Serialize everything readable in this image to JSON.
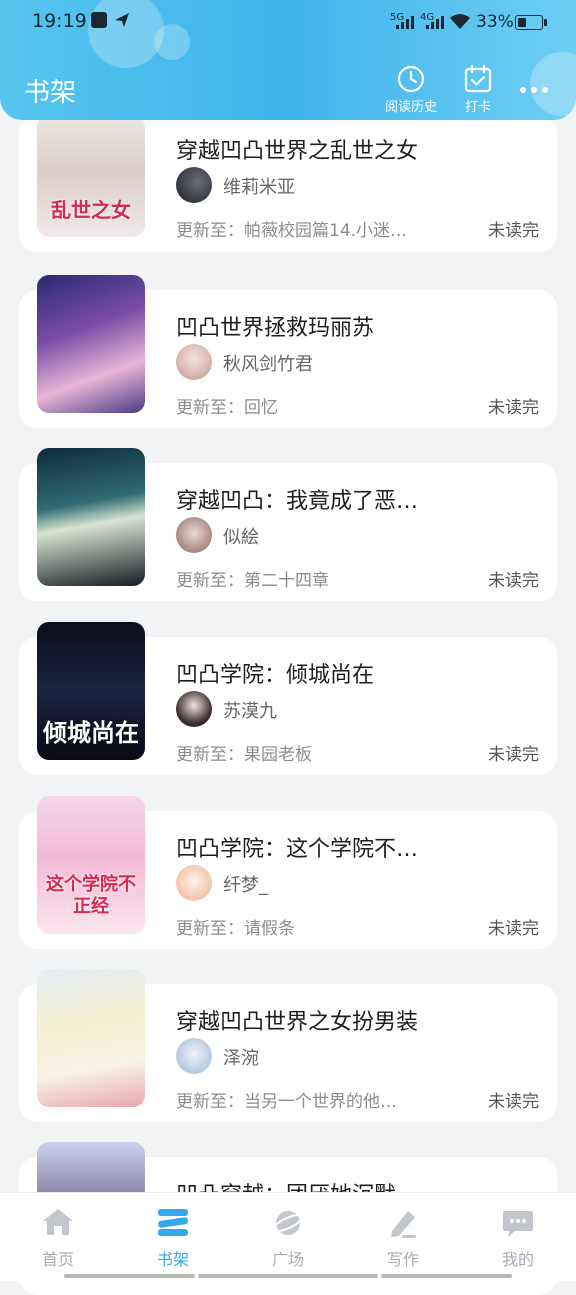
{
  "status_bar": {
    "time": "19:19",
    "network_1": "5G",
    "network_2": "4G",
    "battery": "33%"
  },
  "header": {
    "title": "书架",
    "history_label": "阅读历史",
    "checkin_label": "打卡",
    "history_icon": "clock-icon",
    "checkin_icon": "calendar-check-icon",
    "more_icon": "more-dots-icon"
  },
  "books": [
    {
      "title": "穿越凹凸世界之乱世之女",
      "author": "维莉米亚",
      "update_prefix": "更新至：",
      "update": "帕薇校园篇14.小迷…",
      "read_status": "未读完",
      "cover_text": "乱世之女"
    },
    {
      "title": "凹凸世界拯救玛丽苏",
      "author": "秋风剑竹君",
      "update_prefix": "更新至：",
      "update": "回忆",
      "read_status": "未读完",
      "cover_text": ""
    },
    {
      "title": "穿越凹凸：我竟成了恶…",
      "author": "似絵",
      "update_prefix": "更新至：",
      "update": "第二十四章",
      "read_status": "未读完",
      "cover_text": ""
    },
    {
      "title": "凹凸学院：倾城尚在",
      "author": "苏漠九",
      "update_prefix": "更新至：",
      "update": "果园老板",
      "read_status": "未读完",
      "cover_text": "倾城尚在"
    },
    {
      "title": "凹凸学院：这个学院不…",
      "author": "纤梦_",
      "update_prefix": "更新至：",
      "update": "请假条",
      "read_status": "未读完",
      "cover_text": "这个学院不正经"
    },
    {
      "title": "穿越凹凸世界之女扮男装",
      "author": "泽涴",
      "update_prefix": "更新至：",
      "update": "当另一个世界的他…",
      "read_status": "未读完",
      "cover_text": ""
    },
    {
      "title": "凹凸穿越：团厌她沉默…",
      "author": "",
      "update_prefix": "",
      "update": "",
      "read_status": "",
      "cover_text": ""
    }
  ],
  "tabs": [
    {
      "label": "首页",
      "icon": "home-icon"
    },
    {
      "label": "书架",
      "icon": "bookshelf-icon"
    },
    {
      "label": "广场",
      "icon": "planet-icon"
    },
    {
      "label": "写作",
      "icon": "pen-icon"
    },
    {
      "label": "我的",
      "icon": "chat-bubble-icon"
    }
  ],
  "active_tab": "书架",
  "colors": {
    "accent": "#34a9ea",
    "header_gradient_start": "#56c6ee",
    "header_gradient_end": "#6fcff3",
    "background": "#f2f3f5"
  }
}
